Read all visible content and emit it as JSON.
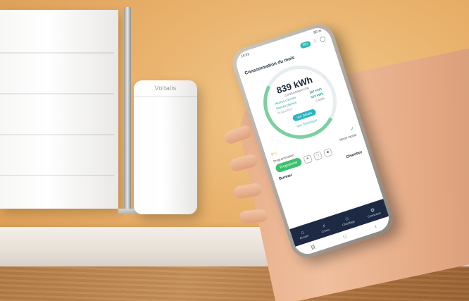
{
  "device_box": {
    "logo": "Voltalis"
  },
  "phone": {
    "status": {
      "time": "14:31",
      "battery": "90 %"
    },
    "header": {
      "badge": "99+",
      "bell_icon": "bell-icon",
      "user_icon": "user-icon"
    },
    "consumption": {
      "title": "Consommation du mois",
      "value": "839 kWh",
      "subtitle": "CONSOMMATION",
      "rows": [
        {
          "label": "Heures creuses",
          "value": "287 kWh"
        },
        {
          "label": "Heures pleines",
          "value": "552 kWh"
        },
        {
          "label": "Production",
          "value": "0 kWh"
        }
      ],
      "details_btn": "Voir Détails",
      "history": "Voir l'historique"
    },
    "weather": {
      "temperature": "9°C"
    },
    "mode": {
      "left": "Programmation",
      "right": "Mode rapide",
      "program_btn": "Programme"
    },
    "rooms": {
      "first": "Bureau",
      "second": "Chambre"
    },
    "nav": [
      {
        "label": "Accueil",
        "icon": "home-icon"
      },
      {
        "label": "Conso",
        "icon": "bolt-icon"
      },
      {
        "label": "Chauffage",
        "icon": "thermo-icon"
      },
      {
        "label": "Connexion",
        "icon": "plug-icon"
      }
    ]
  }
}
